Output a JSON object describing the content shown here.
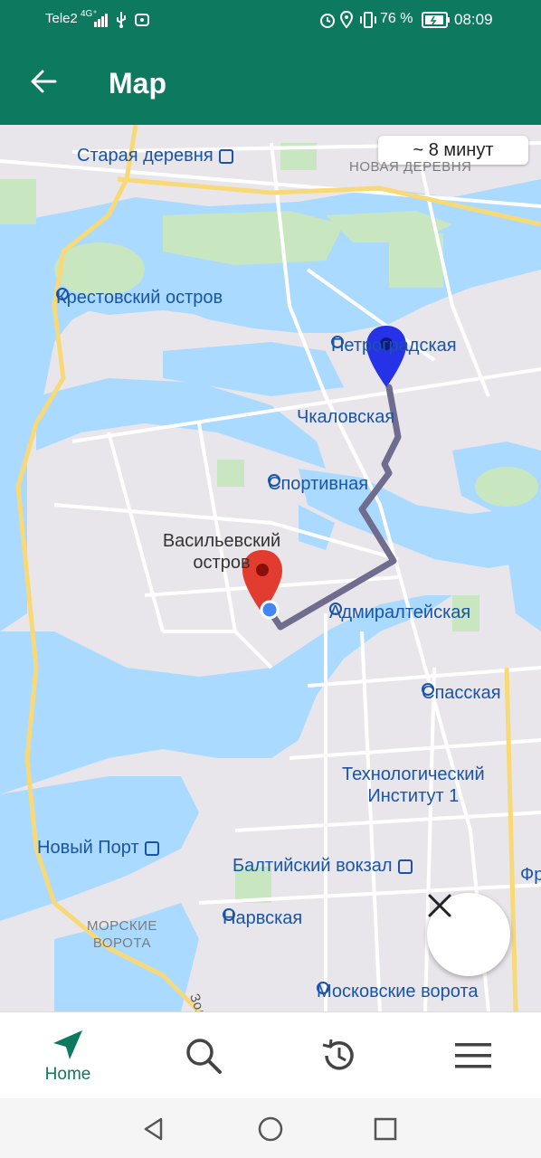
{
  "status_bar": {
    "carrier": "Tele2",
    "network": "4G⁺",
    "battery_percent": "76 %",
    "time": "08:09"
  },
  "app_bar": {
    "title": "Map",
    "back_icon": "arrow-left-icon"
  },
  "map": {
    "eta_chip": "~ 8 минут",
    "labels": {
      "staraya_derevnya": "Старая деревня",
      "novaya_derevnya": "НОВАЯ ДЕРЕВНЯ",
      "krestovsky": "Крестовский остров",
      "petrogradskaya": "Петроградская",
      "chkalovskaya": "Чкаловская",
      "sportivnaya": "Спортивная",
      "vasilievsky_line1": "Васильевский",
      "vasilievsky_line2": "остров",
      "admiralteyskaya": "Адмиралтейская",
      "spasskaya": "Спасская",
      "tekhnologichesky_line1": "Технологический",
      "tekhnologichesky_line2": "Институт 1",
      "novy_port": "Новый Порт",
      "baltiysky": "Балтийский вокзал",
      "narvskaya": "Нарвская",
      "morskie_line1": "МОРСКИЕ",
      "morskie_line2": "ВОРОТА",
      "moskovskie": "Московские ворота",
      "fr": "Фр",
      "zol": "Зол"
    },
    "colors": {
      "water": "#aadaff",
      "land": "#e8e6ea",
      "park": "#c8e6c0",
      "road_major": "#f8d977",
      "route": "#6f6c8e",
      "start_marker": "#2632e6",
      "end_marker": "#e23b30"
    },
    "close_icon": "close-icon"
  },
  "bottom_nav": {
    "items": [
      {
        "label": "Home",
        "icon": "navigation-arrow-icon",
        "active": true
      },
      {
        "label": "",
        "icon": "search-icon",
        "active": false
      },
      {
        "label": "",
        "icon": "history-icon",
        "active": false
      },
      {
        "label": "",
        "icon": "menu-icon",
        "active": false
      }
    ]
  },
  "system_nav": {
    "icons": [
      "back-triangle-icon",
      "home-circle-icon",
      "recents-square-icon"
    ]
  }
}
